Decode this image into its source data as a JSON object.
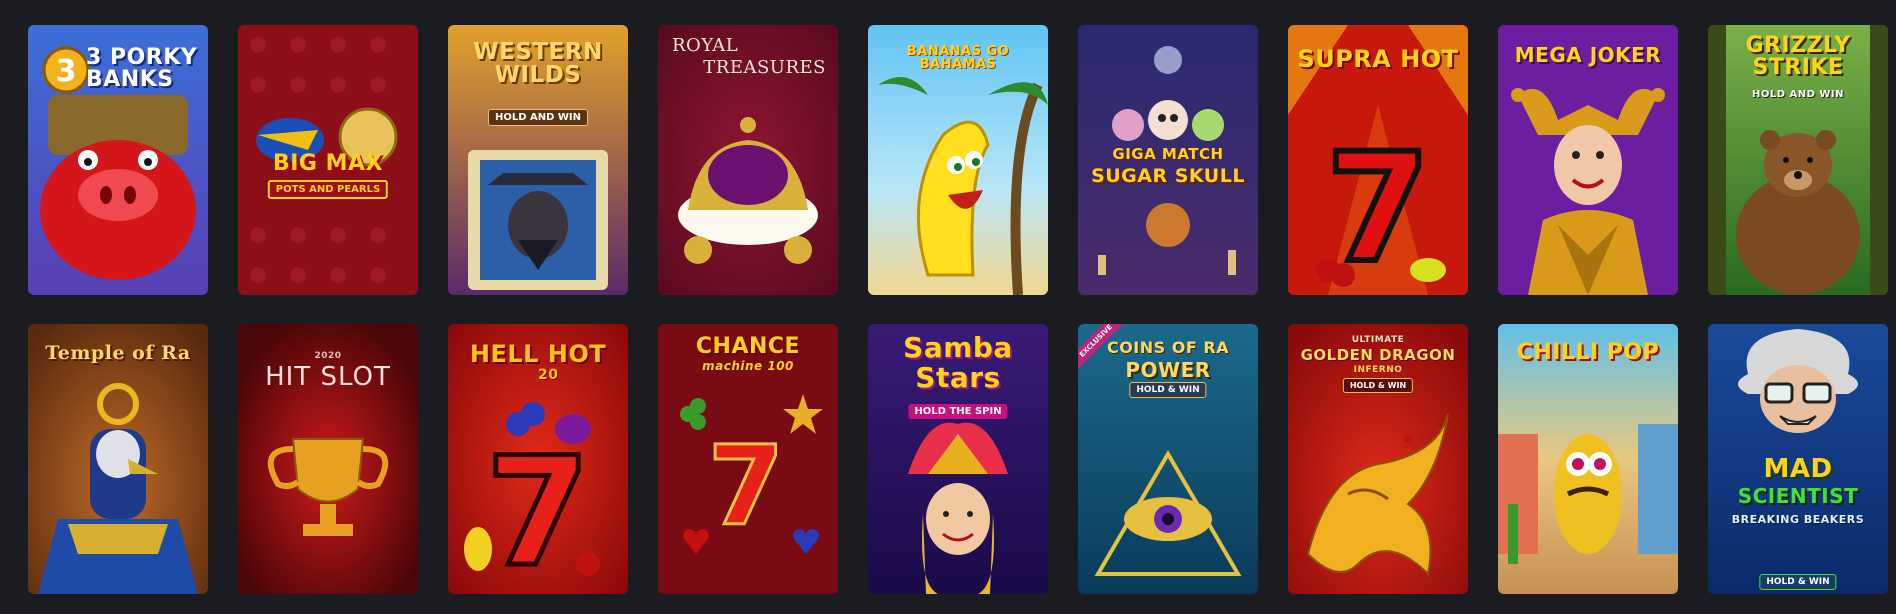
{
  "games": [
    {
      "title": "3 PORKY BANKS"
    },
    {
      "title": "BIG MAX",
      "subtitle": "POTS AND PEARLS"
    },
    {
      "title": "WESTERN WILDS",
      "subtitle": "HOLD AND WIN"
    },
    {
      "title_line1": "ROYAL",
      "title_line2": "TREASURES"
    },
    {
      "title": "BANANAS GO BAHAMAS"
    },
    {
      "title_line1": "GIGA MATCH",
      "title_line2": "SUGAR SKULL"
    },
    {
      "title": "SUPRA HOT"
    },
    {
      "title": "MEGA JOKER"
    },
    {
      "title": "GRIZZLY STRIKE",
      "subtitle": "HOLD AND WIN"
    },
    {
      "title": "Temple of Ra"
    },
    {
      "year": "2020",
      "title": "HIT SLOT"
    },
    {
      "title": "HELL HOT",
      "number": "20"
    },
    {
      "title": "CHANCE",
      "subtitle": "machine 100"
    },
    {
      "title_line1": "Samba",
      "title_line2": "Stars",
      "subtitle": "HOLD THE SPIN"
    },
    {
      "badge": "EXCLUSIVE",
      "title_line1": "COINS OF RA",
      "title_line2": "POWER",
      "subtitle": "HOLD & WIN"
    },
    {
      "kicker": "ULTIMATE",
      "title": "GOLDEN DRAGON",
      "title_sub": "INFERNO",
      "subtitle": "HOLD & WIN"
    },
    {
      "title": "CHILLI POP"
    },
    {
      "title_line1": "MAD",
      "title_line2": "SCIENTIST",
      "title_line3": "BREAKING BEAKERS",
      "subtitle": "HOLD & WIN"
    }
  ]
}
